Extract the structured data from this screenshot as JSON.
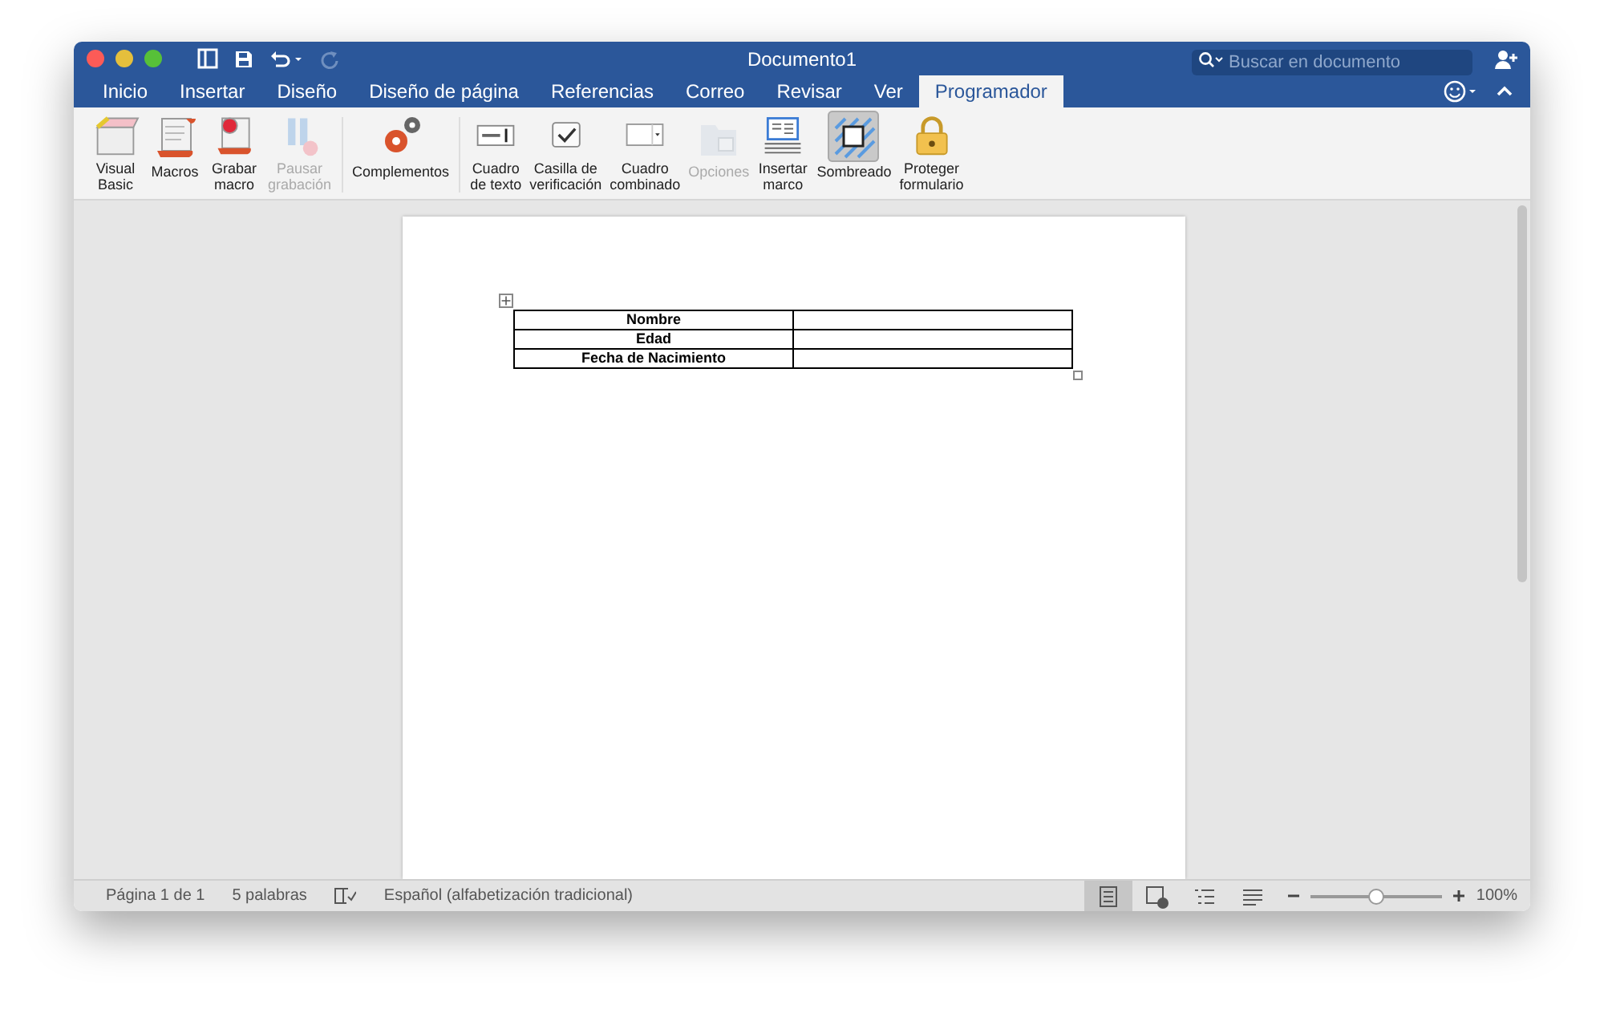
{
  "window": {
    "title": "Documento1"
  },
  "search": {
    "placeholder": "Buscar en documento"
  },
  "tabs": [
    {
      "label": "Inicio",
      "selected": false
    },
    {
      "label": "Insertar",
      "selected": false
    },
    {
      "label": "Diseño",
      "selected": false
    },
    {
      "label": "Diseño de página",
      "selected": false
    },
    {
      "label": "Referencias",
      "selected": false
    },
    {
      "label": "Correo",
      "selected": false
    },
    {
      "label": "Revisar",
      "selected": false
    },
    {
      "label": "Ver",
      "selected": false
    },
    {
      "label": "Programador",
      "selected": true
    }
  ],
  "ribbon": {
    "groups": [
      {
        "buttons": [
          {
            "kind": "vb",
            "label": "Visual\nBasic",
            "disabled": false,
            "selected": false
          },
          {
            "kind": "macros",
            "label": "Macros",
            "disabled": false,
            "selected": false
          },
          {
            "kind": "record",
            "label": "Grabar\nmacro",
            "disabled": false,
            "selected": false
          },
          {
            "kind": "pause",
            "label": "Pausar\ngrabación",
            "disabled": true,
            "selected": false
          }
        ]
      },
      {
        "buttons": [
          {
            "kind": "addins",
            "label": "Complementos",
            "disabled": false,
            "selected": false
          }
        ]
      },
      {
        "buttons": [
          {
            "kind": "textbox",
            "label": "Cuadro\nde texto",
            "disabled": false,
            "selected": false
          },
          {
            "kind": "checkbox",
            "label": "Casilla de\nverificación",
            "disabled": false,
            "selected": false
          },
          {
            "kind": "combo",
            "label": "Cuadro\ncombinado",
            "disabled": false,
            "selected": false
          },
          {
            "kind": "options",
            "label": "Opciones",
            "disabled": true,
            "selected": false
          },
          {
            "kind": "frame",
            "label": "Insertar\nmarco",
            "disabled": false,
            "selected": false
          },
          {
            "kind": "shading",
            "label": "Sombreado",
            "disabled": false,
            "selected": true
          },
          {
            "kind": "lock",
            "label": "Proteger\nformulario",
            "disabled": false,
            "selected": false
          }
        ]
      }
    ]
  },
  "document": {
    "table": {
      "rows": [
        {
          "label": "Nombre",
          "value": ""
        },
        {
          "label": "Edad",
          "value": ""
        },
        {
          "label": "Fecha de Nacimiento",
          "value": ""
        }
      ]
    }
  },
  "status_bar": {
    "page": "Página 1 de 1",
    "words": "5 palabras",
    "language": "Español (alfabetización tradicional)",
    "views": [
      {
        "kind": "print",
        "selected": true
      },
      {
        "kind": "web",
        "selected": false
      },
      {
        "kind": "outline",
        "selected": false
      },
      {
        "kind": "draft",
        "selected": false
      }
    ],
    "zoom": {
      "level": 0.5,
      "reading": "100%"
    }
  }
}
